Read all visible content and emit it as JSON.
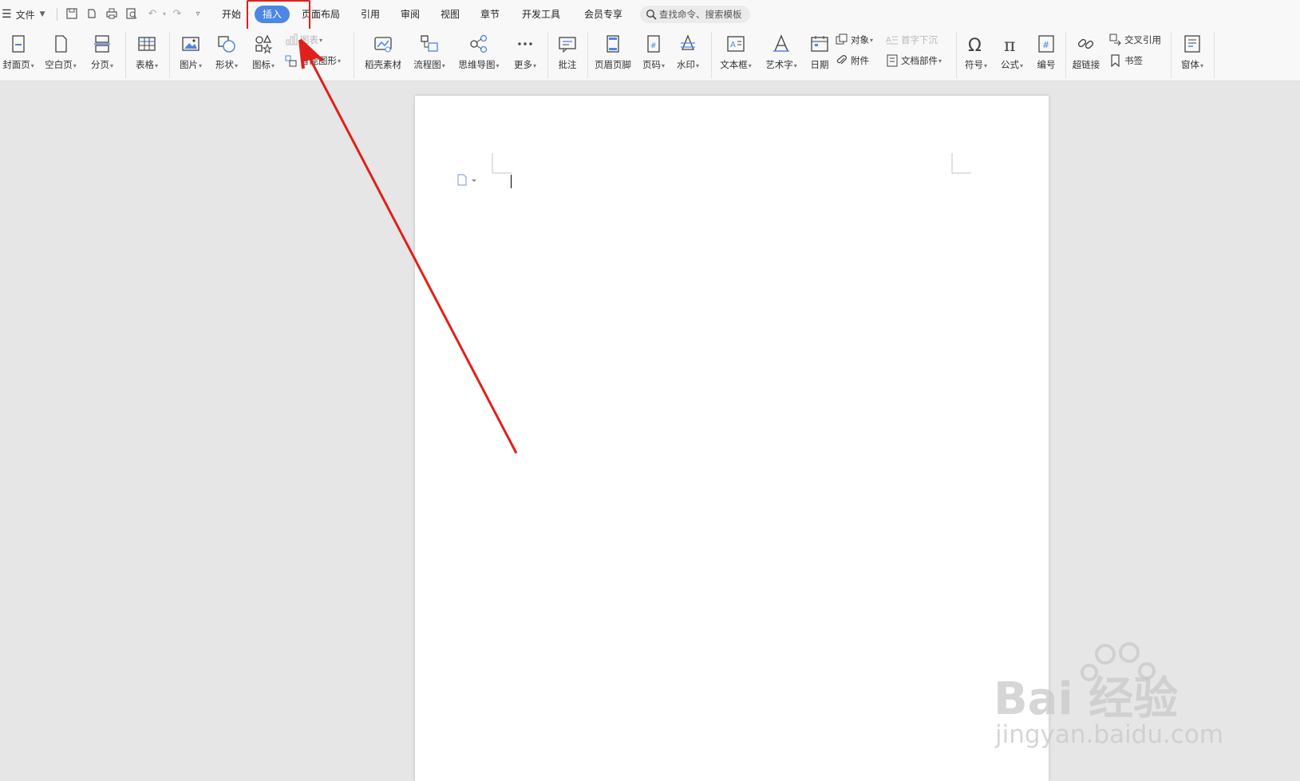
{
  "menu": {
    "file_label": "文件"
  },
  "tabs": [
    {
      "label": "开始"
    },
    {
      "label": "插入"
    },
    {
      "label": "页面布局"
    },
    {
      "label": "引用"
    },
    {
      "label": "审阅"
    },
    {
      "label": "视图"
    },
    {
      "label": "章节"
    },
    {
      "label": "开发工具"
    },
    {
      "label": "会员专享"
    }
  ],
  "active_tab": "插入",
  "search": {
    "placeholder": "查找命令、搜索模板"
  },
  "ribbon": {
    "cover_page": "封面页",
    "blank_page": "空白页",
    "page_break": "分页",
    "table": "表格",
    "picture": "图片",
    "shape": "形状",
    "icon": "图标",
    "chart": "图表",
    "smart_art": "智能图形",
    "daoke_assets": "稻壳素材",
    "flowchart": "流程图",
    "mind_map": "思维导图",
    "more": "更多",
    "comment": "批注",
    "header_footer": "页眉页脚",
    "page_number": "页码",
    "watermark": "水印",
    "text_box": "文本框",
    "word_art": "艺术字",
    "date": "日期",
    "object": "对象",
    "attachment": "附件",
    "drop_cap": "首字下沉",
    "doc_parts": "文档部件",
    "symbol": "符号",
    "equation": "公式",
    "numbering": "编号",
    "hyperlink": "超链接",
    "cross_reference": "交叉引用",
    "bookmark": "书签",
    "window": "窗体"
  },
  "watermark": {
    "brand": "Bai 经验",
    "url": "jingyan.baidu.com"
  },
  "colors": {
    "accent": "#4c86e6",
    "annotation_red": "#e0201b"
  }
}
